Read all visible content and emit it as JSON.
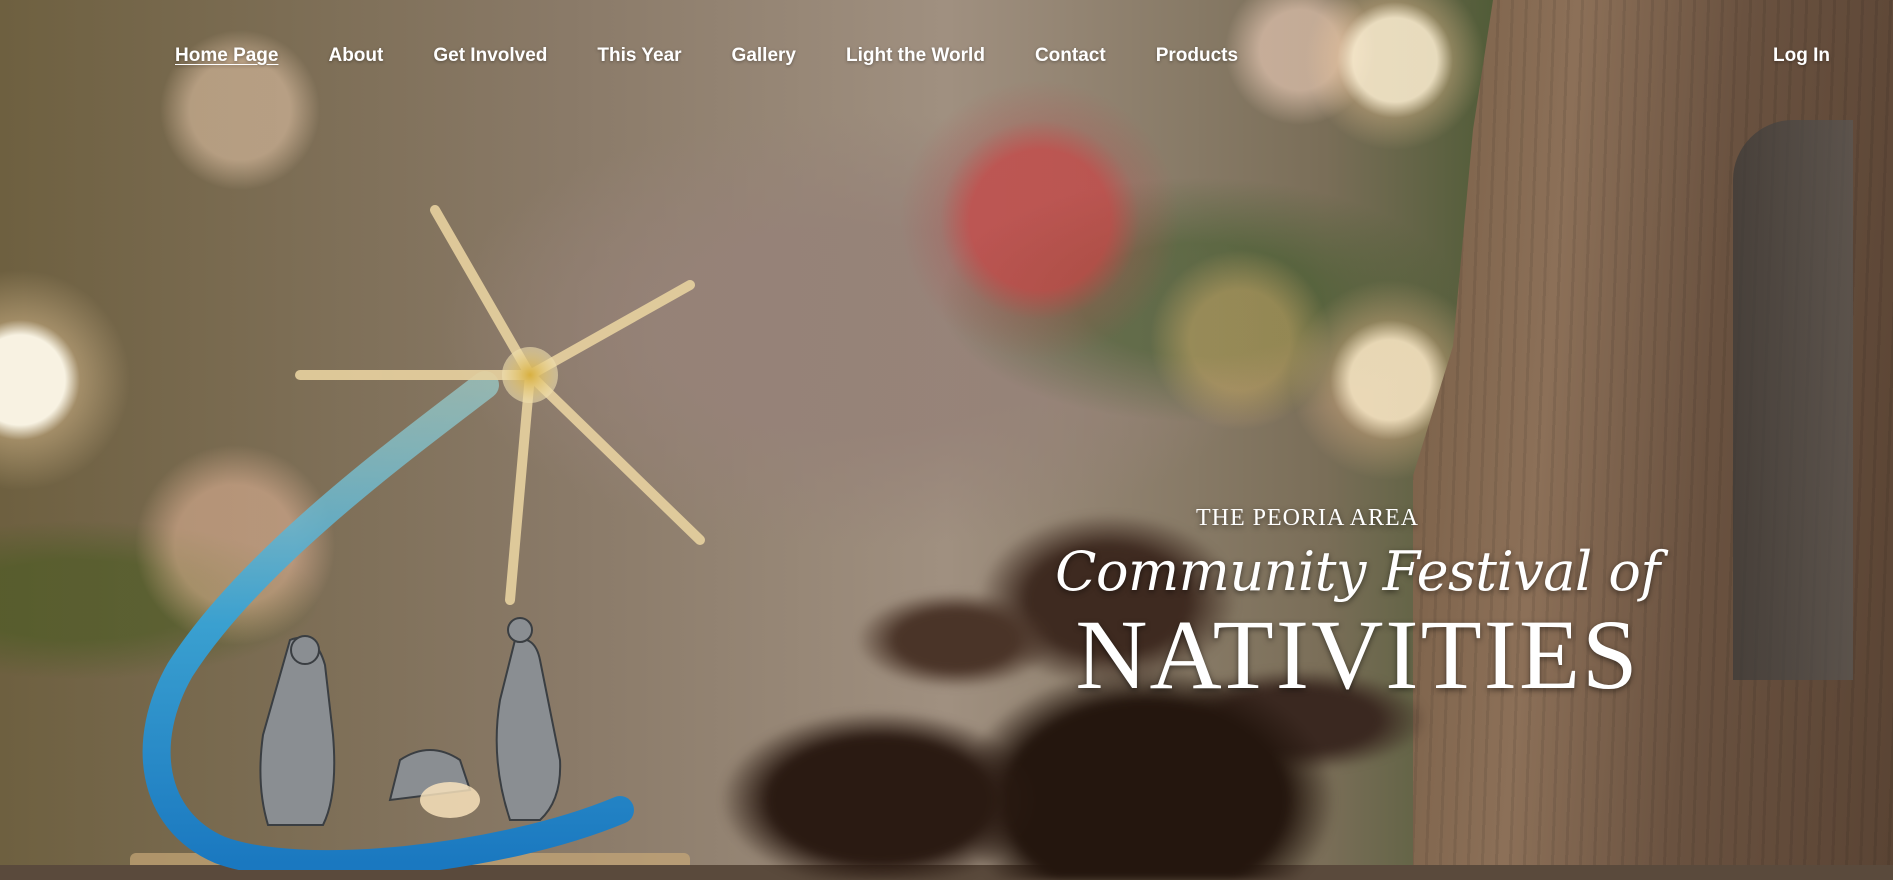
{
  "nav": {
    "links": [
      {
        "label": "Home Page",
        "active": true
      },
      {
        "label": "About"
      },
      {
        "label": "Get Involved"
      },
      {
        "label": "This Year"
      },
      {
        "label": "Gallery"
      },
      {
        "label": "Light the World"
      },
      {
        "label": "Contact"
      },
      {
        "label": "Products"
      }
    ],
    "login_label": "Log In"
  },
  "hero": {
    "eyebrow": "THE PEORIA AREA",
    "script_title": "Community Festival of",
    "big_title": "NATIVITIES"
  },
  "colors": {
    "nav_text": "#ffffff",
    "glass_star": "#e8d2a0",
    "glass_blue": "#2aa0d8"
  }
}
